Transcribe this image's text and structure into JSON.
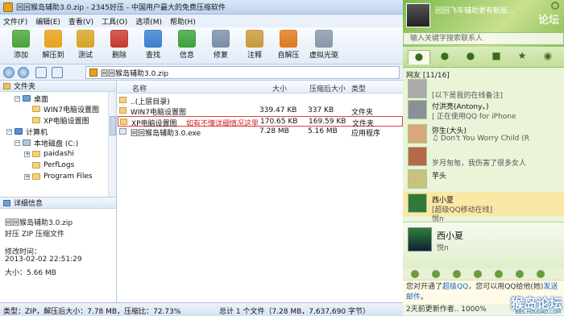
{
  "window": {
    "title": "回回猴岛辅助3.0.zip - 2345好压 - 中国用户最大的免费压缩软件"
  },
  "menu": [
    "文件(F)",
    "编辑(E)",
    "查看(V)",
    "工具(O)",
    "选项(M)",
    "帮助(H)"
  ],
  "toolbar": [
    {
      "label": "添加",
      "icon": "add-icon",
      "color": "#4aa33a"
    },
    {
      "label": "解压到",
      "icon": "extract-icon",
      "color": "#e8a21b"
    },
    {
      "label": "测试",
      "icon": "test-icon",
      "color": "#d9a426"
    },
    {
      "label": "删除",
      "icon": "delete-icon",
      "color": "#c83a2e"
    },
    {
      "label": "查找",
      "icon": "find-icon",
      "color": "#3c7fd0"
    },
    {
      "label": "信息",
      "icon": "info-icon",
      "color": "#3da13a"
    },
    {
      "label": "修复",
      "icon": "repair-icon",
      "color": "#7a8faa"
    },
    {
      "label": "注释",
      "icon": "comment-icon",
      "color": "#c89a3a"
    },
    {
      "label": "自解压",
      "icon": "sfx-icon",
      "color": "#e07a1d"
    },
    {
      "label": "虚拟光驱",
      "icon": "virtual-drive-icon",
      "color": "#8a97a8"
    }
  ],
  "address": {
    "value": "回回猴岛辅助3.0.zip"
  },
  "tree": {
    "header": "文件夹",
    "nodes": [
      {
        "label": "桌面",
        "kind": "blue",
        "expander": "−"
      },
      {
        "label": "WIN7电脑设置图",
        "kind": "folder",
        "expander": ""
      },
      {
        "label": "XP电脑设置图",
        "kind": "folder",
        "expander": ""
      },
      {
        "label": "计算机",
        "kind": "pc",
        "expander": "−"
      },
      {
        "label": "本地磁盘 (C:)",
        "kind": "disk",
        "expander": "−"
      },
      {
        "label": "paidashi",
        "kind": "folder",
        "expander": "+"
      },
      {
        "label": "PerfLogs",
        "kind": "folder",
        "expander": ""
      },
      {
        "label": "Program Files",
        "kind": "folder",
        "expander": "+"
      }
    ]
  },
  "details": {
    "header": "详细信息",
    "filename": "回回猴岛辅助3.0.zip",
    "filetype": "好压 ZIP 压缩文件",
    "modified_label": "修改时间：",
    "modified_value": "2013-02-02 22:51:29",
    "size": "大小：5.66 MB"
  },
  "columns": {
    "name": "名称",
    "size": "大小",
    "packed": "压缩后大小",
    "type": "类型"
  },
  "files": [
    {
      "name": "..(上层目录)",
      "size": "",
      "packed": "",
      "type": "",
      "icon": "folder"
    },
    {
      "name": "WIN7电脑设置图",
      "size": "339.47 KB",
      "packed": "337 KB",
      "type": "文件夹",
      "icon": "folder"
    },
    {
      "name": "XP电脑设置图",
      "size": "170.65 KB",
      "packed": "169.59 KB",
      "type": "文件夹",
      "icon": "folder",
      "note": "如有不懂详细情况这里"
    },
    {
      "name": "回回猴岛辅助3.0.exe",
      "size": "7.28 MB",
      "packed": "5.16 MB",
      "type": "应用程序",
      "icon": "exe"
    }
  ],
  "status": {
    "left": "类型：ZIP，解压后大小：7.78 MB，压缩比：72.73%",
    "right": "总计 1 个文件（7.28 MB，7,637,690 字节）"
  },
  "qq": {
    "account_name": "回回飞车辅助更有新版...",
    "watermark": "论坛",
    "search_placeholder": "输入关键字搜索联系人",
    "group_header": "网友 [11/16]",
    "contacts": [
      {
        "name": "",
        "signature": "[以下是我的在线备注]",
        "avatar_color": "#aaaaaa"
      },
      {
        "name": "付洪亮(Antony。)",
        "signature": "| 正在使用QQ for iPhone",
        "avatar_color": "#8a8f98"
      },
      {
        "name": "弥生(大头)",
        "signature": "♫ Don't You Worry Child (R",
        "avatar_color": "#d7a87a"
      },
      {
        "name": "",
        "signature": "岁月匆匆，我伤害了很多女人",
        "avatar_color": "#b46a4a"
      },
      {
        "name": "芋头",
        "signature": "",
        "avatar_color": "#c9c27f"
      },
      {
        "name": "西小夏",
        "signature": "[超级QQ移动在线]",
        "avatar_color": "#2f7a3a",
        "extra": "悦n"
      }
    ],
    "profile": {
      "name": "西小夏",
      "signature": "悦n"
    },
    "notice": {
      "text": "您对开通了",
      "link1": "超级QQ",
      "text2": "，您可以用QQ给他(她)",
      "link2": "发送邮件",
      "text3": "。"
    },
    "bottom": "2天前更新作者.. 1000%",
    "site_watermark": "猴岛论坛",
    "site_url": "BBS.HOUDAO.COM"
  }
}
